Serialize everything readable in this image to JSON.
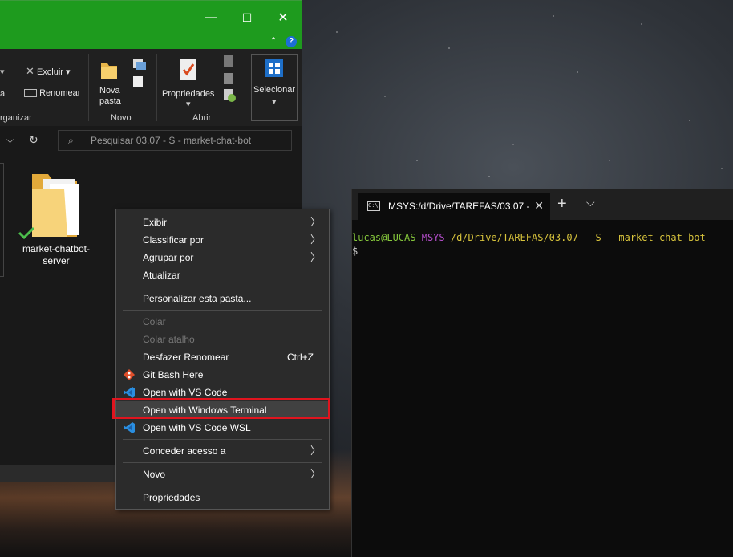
{
  "explorer": {
    "window_buttons": {
      "minimize": "—",
      "maximize": "☐",
      "close": "✕"
    },
    "ribbon": {
      "excluir": "Excluir",
      "renomear": "Renomear",
      "partial_a": "a",
      "organizar_group": "rganizar",
      "nova_pasta": "Nova\npasta",
      "novo_group": "Novo",
      "propriedades": "Propriedades",
      "abrir_group": "Abrir",
      "selecionar": "Selecionar"
    },
    "search_placeholder": "Pesquisar 03.07 - S - market-chat-bot",
    "folder": {
      "name": "market-chatbot-\nserver"
    }
  },
  "context_menu": {
    "items": [
      {
        "label": "Exibir",
        "submenu": true
      },
      {
        "label": "Classificar por",
        "submenu": true
      },
      {
        "label": "Agrupar por",
        "submenu": true
      },
      {
        "label": "Atualizar"
      },
      {
        "label": "Personalizar esta pasta..."
      },
      {
        "label": "Colar",
        "disabled": true
      },
      {
        "label": "Colar atalho",
        "disabled": true
      },
      {
        "label": "Desfazer Renomear",
        "shortcut": "Ctrl+Z"
      },
      {
        "label": "Git Bash Here",
        "icon": "git-bash-icon"
      },
      {
        "label": "Open with VS Code",
        "icon": "vscode-icon"
      },
      {
        "label": "Open with Windows Terminal"
      },
      {
        "label": "Open with VS Code WSL",
        "icon": "vscode-icon"
      },
      {
        "label": "Conceder acesso a",
        "submenu": true
      },
      {
        "label": "Novo",
        "submenu": true
      },
      {
        "label": "Propriedades"
      }
    ],
    "highlight_color": "#e0141e"
  },
  "terminal": {
    "tab_title": "MSYS:/d/Drive/TAREFAS/03.07 -",
    "new_tab": "+",
    "dropdown": "⌵",
    "prompt_user": "lucas@LUCAS",
    "prompt_env": "MSYS",
    "prompt_path": "/d/Drive/TAREFAS/03.07 - S - market-chat-bot",
    "prompt_symbol": "$"
  }
}
